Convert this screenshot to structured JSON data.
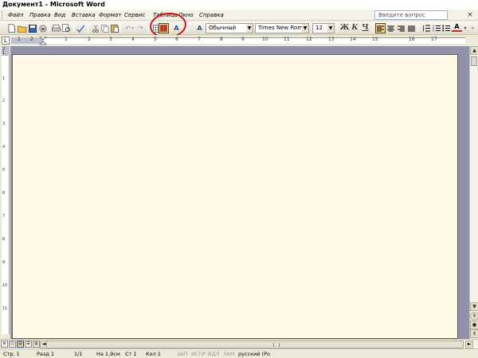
{
  "window": {
    "title": "Документ1 - Microsoft Word"
  },
  "menu": {
    "items": [
      "Файл",
      "Правка",
      "Вид",
      "Вставка",
      "Формат",
      "Сервис",
      "Таблица",
      "Окно",
      "Справка"
    ],
    "help_placeholder": "Введите вопрос",
    "close_glyph": "×"
  },
  "toolbar": {
    "style_value": "Обычный",
    "font_value": "Times New Roman",
    "size_value": "12",
    "bold_label": "Ж",
    "italic_label": "К",
    "underline_label": "Ч",
    "font_color_label": "A",
    "reading_mode_label": "Чтение"
  },
  "ruler": {
    "h_labels": [
      "1",
      "2",
      "1",
      "2",
      "3",
      "4",
      "5",
      "6",
      "7",
      "8",
      "9",
      "10",
      "11",
      "12",
      "13",
      "14",
      "15",
      "16",
      "17"
    ],
    "v_labels": [
      "2",
      "1",
      "1",
      "2",
      "3",
      "4",
      "5",
      "6",
      "7",
      "8",
      "9",
      "10",
      "11"
    ]
  },
  "statusbar": {
    "page": "Стр. 1",
    "section": "Разд 1",
    "page_of": "1/1",
    "position": "На 1,9см",
    "line": "Ст 1",
    "column": "Кол 1",
    "rec": "ЗАП",
    "trk": "ИСПР",
    "ext": "ВДЛ",
    "ovr": "ЗАМ",
    "language": "русский (Ро"
  },
  "annotation": {
    "color": "#d3141b",
    "target": "reading-mode-button"
  }
}
